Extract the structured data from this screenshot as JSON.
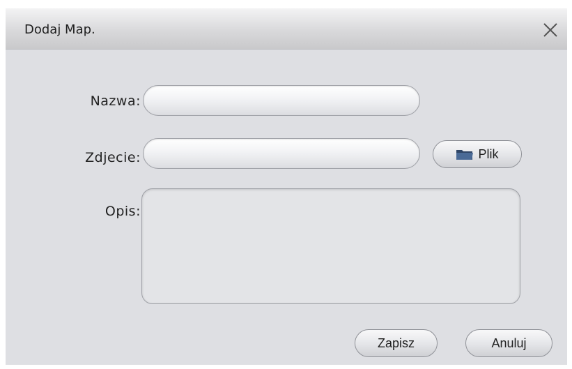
{
  "dialog": {
    "title": "Dodaj Map.",
    "close_icon": "close-icon"
  },
  "form": {
    "name_label": "Nazwa:",
    "name_value": "",
    "image_label": "Zdjecie:",
    "image_value": "",
    "file_button_label": "Plik",
    "file_button_icon": "folder-icon",
    "description_label": "Opis:",
    "description_value": ""
  },
  "footer": {
    "save_label": "Zapisz",
    "cancel_label": "Anuluj"
  },
  "colors": {
    "dialog_background": "#dedfe3",
    "folder_icon": "#3a4f6e"
  }
}
